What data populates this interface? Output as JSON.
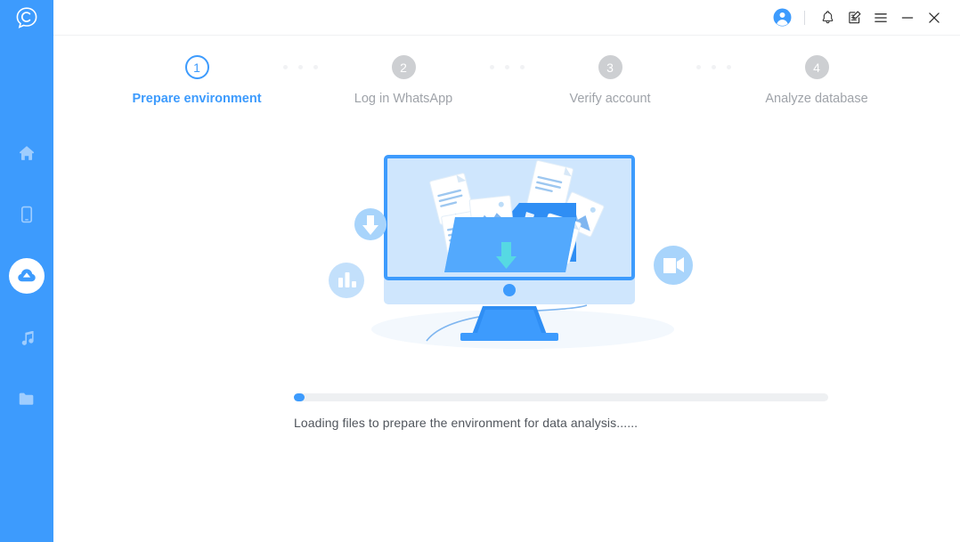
{
  "app": {
    "logo_icon": "chat-bubble-c-logo",
    "brand_color": "#3d9bfd",
    "sidebar_bg": "#3d9bfd",
    "pending_color": "#cdcfd2",
    "muted_text": "#9fa3a9"
  },
  "sidebar": {
    "items": [
      {
        "name": "home",
        "icon": "home-icon",
        "active": false
      },
      {
        "name": "phone",
        "icon": "mobile-phone-icon",
        "active": false
      },
      {
        "name": "cloud-recovery",
        "icon": "cloud-upload-icon",
        "active": true
      },
      {
        "name": "music",
        "icon": "music-note-icon",
        "active": false
      },
      {
        "name": "files",
        "icon": "folder-icon",
        "active": false
      }
    ]
  },
  "titlebar": {
    "avatar_icon": "user-avatar-icon",
    "buttons": [
      {
        "name": "notifications",
        "icon": "bell-icon"
      },
      {
        "name": "feedback",
        "icon": "note-edit-icon"
      },
      {
        "name": "menu",
        "icon": "hamburger-menu-icon"
      },
      {
        "name": "minimize",
        "icon": "minimize-icon"
      },
      {
        "name": "close",
        "icon": "close-icon"
      }
    ]
  },
  "stepper": {
    "steps": [
      {
        "number": "1",
        "label": "Prepare environment",
        "state": "current"
      },
      {
        "number": "2",
        "label": "Log in WhatsApp",
        "state": "pending"
      },
      {
        "number": "3",
        "label": "Verify account",
        "state": "pending"
      },
      {
        "number": "4",
        "label": "Analyze database",
        "state": "pending"
      }
    ]
  },
  "illustration": {
    "name": "computer-files-download-illustration",
    "badges": [
      {
        "name": "download-badge",
        "icon": "download-arrow-icon"
      },
      {
        "name": "chart-badge",
        "icon": "bar-chart-icon"
      },
      {
        "name": "video-badge",
        "icon": "video-camera-icon"
      }
    ]
  },
  "progress": {
    "percent": 1,
    "percent_css": "1%",
    "status_text": "Loading files to prepare the environment for data analysis......"
  }
}
